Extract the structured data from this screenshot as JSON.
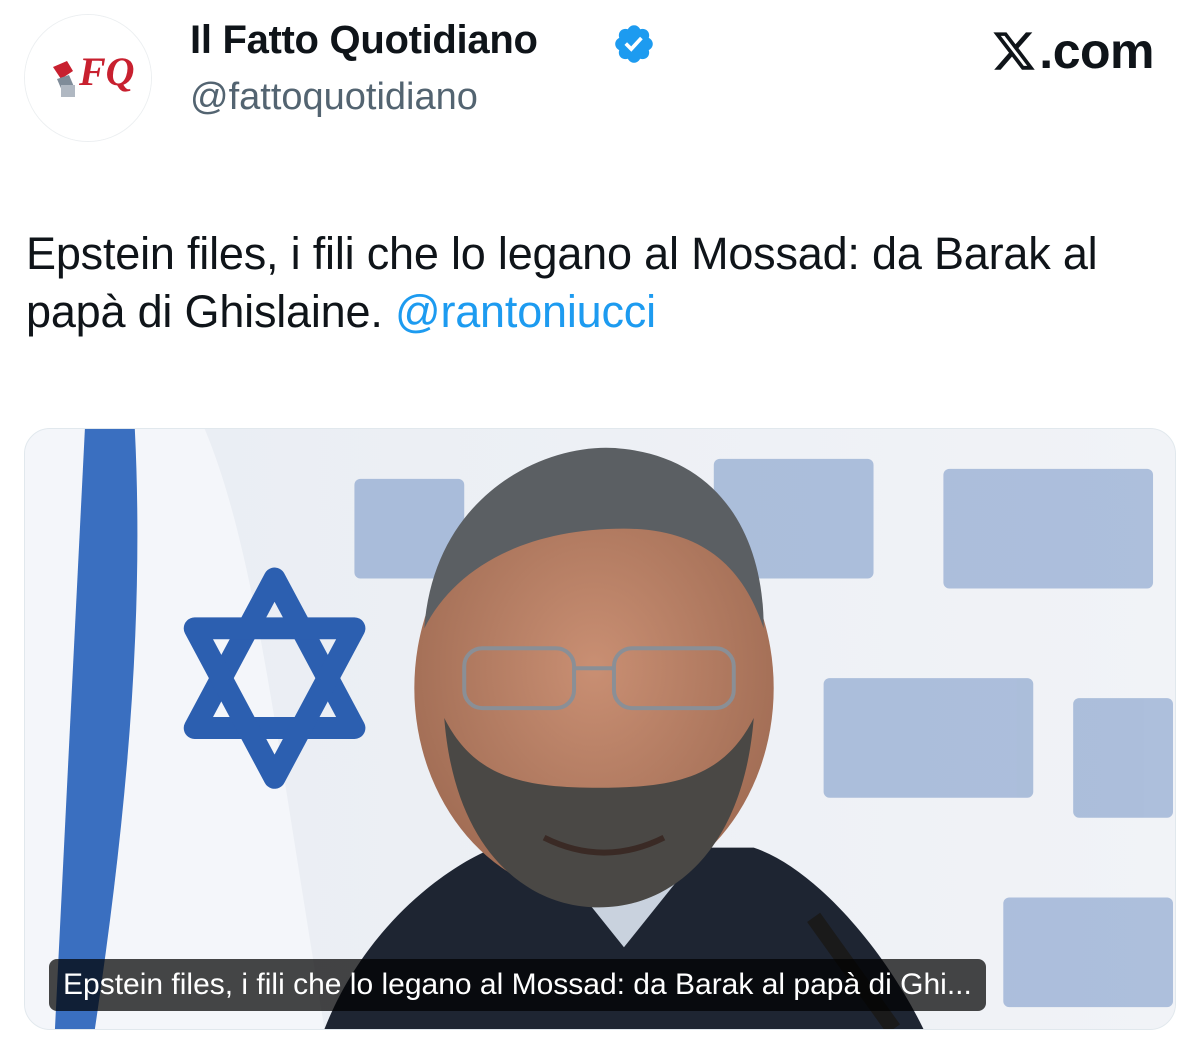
{
  "header": {
    "display_name": "Il Fatto Quotidiano",
    "handle": "@fattoquotidiano",
    "avatar_letters": "FQ",
    "verified_icon": "verified-badge-icon",
    "brand": ".com",
    "brand_icon": "x-logo-icon"
  },
  "tweet": {
    "text": "Epstein files, i fili che lo legano al Mossad: da Barak al papà di Ghislaine.",
    "mention": "@rantoniucci"
  },
  "media": {
    "caption": "Epstein files, i fili che lo legano al Mossad: da Barak al papà di Ghi..."
  },
  "colors": {
    "accent": "#1d9bf0",
    "text": "#0f1419",
    "secondary": "#536471",
    "avatar_red": "#c8202f",
    "flag_blue": "#2c5fb0"
  }
}
